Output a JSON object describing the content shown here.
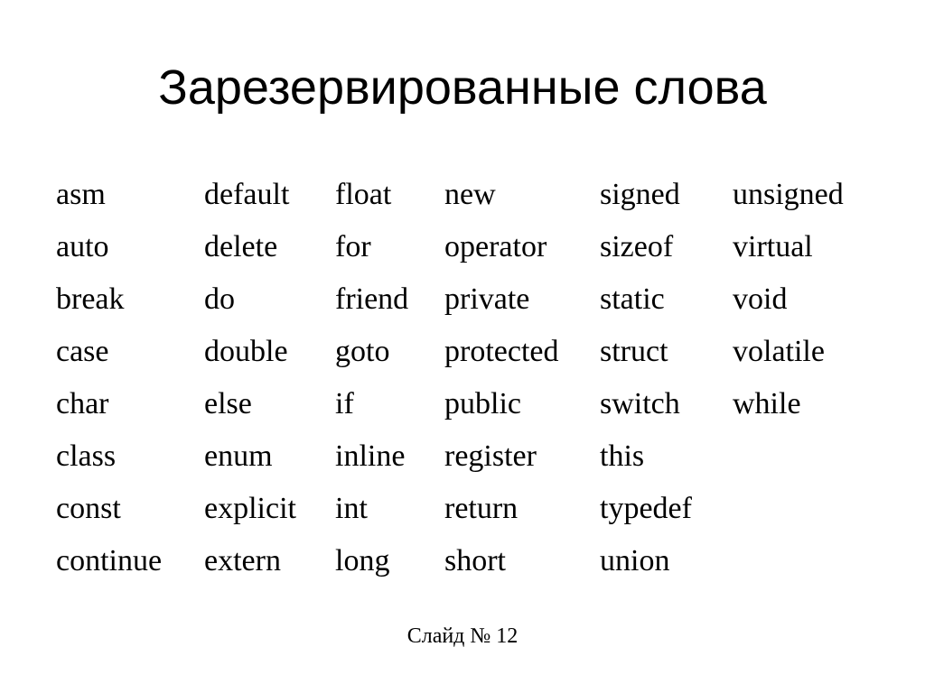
{
  "title": "Зарезервированные слова",
  "columns": [
    [
      "asm",
      "auto",
      "break",
      "case",
      "char",
      "class",
      "const",
      "continue"
    ],
    [
      "default",
      "delete",
      "do",
      "double",
      "else",
      "enum",
      "explicit",
      "extern"
    ],
    [
      "float",
      "for",
      "friend",
      "goto",
      "if",
      "inline",
      "int",
      "long"
    ],
    [
      "new",
      "operator",
      "private",
      "protected",
      "public",
      "register",
      "return",
      "short"
    ],
    [
      "signed",
      "sizeof",
      "static",
      "struct",
      "switch",
      "this",
      "typedef",
      "union"
    ],
    [
      "unsigned",
      "virtual",
      "void",
      "volatile",
      "while"
    ]
  ],
  "footer": "Слайд № 12"
}
